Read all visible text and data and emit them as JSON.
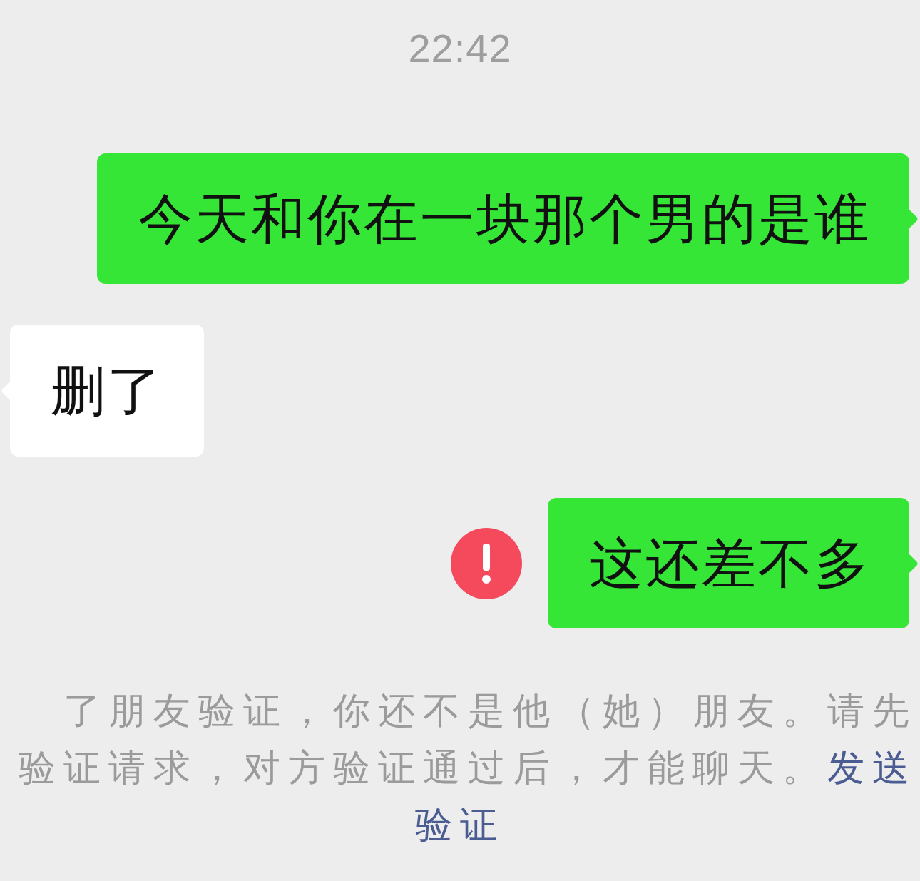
{
  "time": "22:42",
  "messages": [
    {
      "kind": "sent",
      "text": "今天和你在一块那个男的是谁",
      "failed": false
    },
    {
      "kind": "received",
      "text": "删了",
      "failed": false
    },
    {
      "kind": "sent",
      "text": "这还差不多",
      "failed": true
    }
  ],
  "notice": {
    "lines": [
      {
        "text": "了朋友验证，你还不是他（她）朋友。请先"
      },
      {
        "text": "验证请求，对方验证通过后，才能聊天。",
        "link": "发送"
      },
      {
        "link": "验证"
      }
    ]
  }
}
